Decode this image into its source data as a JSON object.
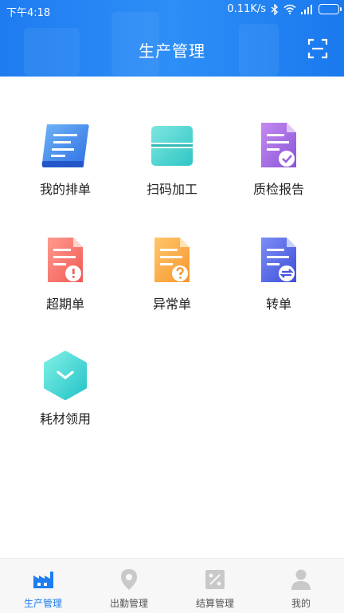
{
  "status_bar": {
    "time": "下午4:18",
    "network_speed": "0.11K/s"
  },
  "header": {
    "title": "生产管理"
  },
  "menu": [
    {
      "label": "我的排单",
      "icon": "scroll-list-icon"
    },
    {
      "label": "扫码加工",
      "icon": "scan-code-icon"
    },
    {
      "label": "质检报告",
      "icon": "report-check-icon"
    },
    {
      "label": "超期单",
      "icon": "overdue-doc-icon"
    },
    {
      "label": "异常单",
      "icon": "exception-doc-icon"
    },
    {
      "label": "转单",
      "icon": "transfer-doc-icon"
    },
    {
      "label": "耗材领用",
      "icon": "hexagon-supply-icon"
    }
  ],
  "tabs": [
    {
      "label": "生产管理",
      "icon": "factory-icon",
      "active": true
    },
    {
      "label": "出勤管理",
      "icon": "location-pin-icon",
      "active": false
    },
    {
      "label": "结算管理",
      "icon": "percent-icon",
      "active": false
    },
    {
      "label": "我的",
      "icon": "user-icon",
      "active": false
    }
  ],
  "colors": {
    "primary": "#1e7df0"
  }
}
